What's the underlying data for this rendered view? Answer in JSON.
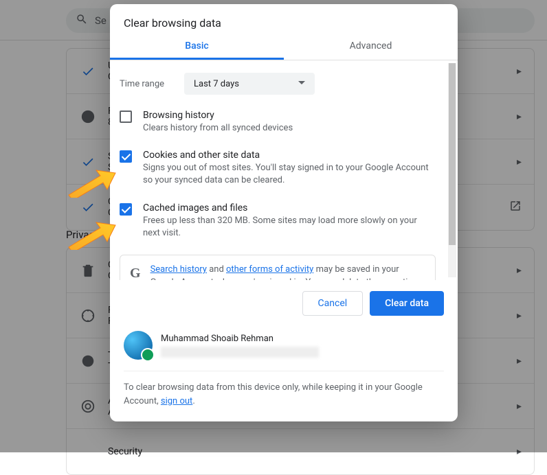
{
  "background": {
    "search_placeholder": "Se",
    "section_title": "Privac",
    "security_row": "Security",
    "row_letters": [
      "U",
      "C",
      "F",
      "8",
      "S",
      "S",
      "C",
      "C",
      "F",
      "F",
      "T",
      "T",
      "A",
      "A"
    ]
  },
  "dialog": {
    "title": "Clear browsing data",
    "tabs": {
      "basic": "Basic",
      "advanced": "Advanced"
    },
    "time_range": {
      "label": "Time range",
      "value": "Last 7 days"
    },
    "options": [
      {
        "title": "Browsing history",
        "desc": "Clears history from all synced devices",
        "checked": false
      },
      {
        "title": "Cookies and other site data",
        "desc": "Signs you out of most sites. You'll stay signed in to your Google Account so your synced data can be cleared.",
        "checked": true
      },
      {
        "title": "Cached images and files",
        "desc": "Frees up less than 320 MB. Some sites may load more slowly on your next visit.",
        "checked": true
      }
    ],
    "notice": {
      "logo": "G",
      "link1": "Search history",
      "mid1": " and ",
      "link2": "other forms of activity",
      "rest": " may be saved in your Google Account when you're signed in. You can delete them anytime."
    },
    "buttons": {
      "cancel": "Cancel",
      "clear": "Clear data"
    },
    "avatar_name": "Muhammad Shoaib Rehman",
    "footer": {
      "text": "To clear browsing data from this device only, while keeping it in your Google Account, ",
      "link": "sign out",
      "tail": "."
    }
  }
}
